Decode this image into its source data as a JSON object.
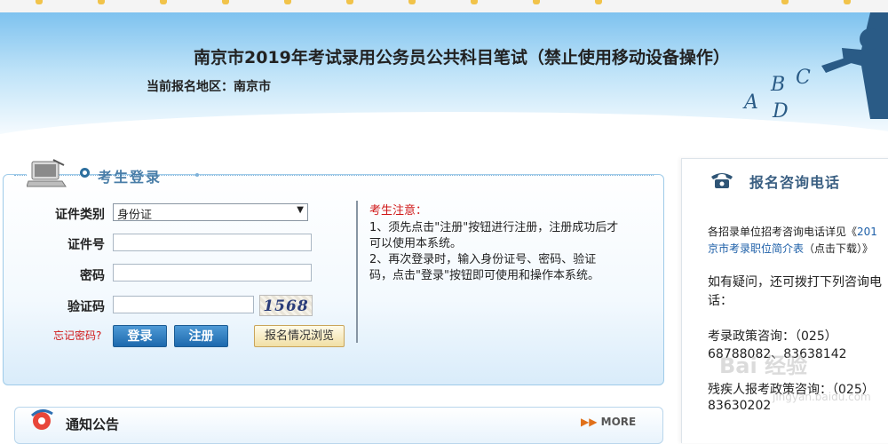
{
  "banner": {
    "title": "南京市2019年考试录用公务员公共科目笔试（禁止使用移动设备操作）",
    "region_label": "当前报名地区：",
    "region_value": "南京市",
    "art_letters": [
      "A",
      "B",
      "C",
      "D"
    ]
  },
  "login": {
    "title": "考生登录",
    "id_type_label": "证件类别",
    "id_type_value": "身份证",
    "id_number_label": "证件号",
    "password_label": "密码",
    "captcha_label": "验证码",
    "captcha_code": "1568",
    "forgot_password": "忘记密码?",
    "login_button": "登录",
    "register_button": "注册",
    "browse_button": "报名情况浏览"
  },
  "notice": {
    "title": "考生注意：",
    "lines": [
      "1、须先点击\"注册\"按钮进行注册，注册成功后才",
      "可以使用本系统。",
      "2、再次登录时，输入身份证号、密码、验证",
      "码，点击\"登录\"按钮即可使用和操作本系统。"
    ]
  },
  "consult": {
    "title": "报名咨询电话",
    "intro_text": "各招录单位招考咨询电话详见《",
    "intro_link": "201",
    "link_line2": "京市考录职位简介表",
    "download_text": "（点击下载）》",
    "question_line1": "如有疑问，还可拨打下列咨询电",
    "question_line2": "话：",
    "policy_label": "考录政策咨询：（025）",
    "policy_numbers": "68788082、83638142",
    "disabled_label": "残疾人报考政策咨询：（025）",
    "disabled_number": "83630202"
  },
  "announcement": {
    "title": "通知公告",
    "more": "MORE"
  },
  "watermark": {
    "text": "Bai 经验",
    "sub": "jingyan.baidu.com"
  },
  "colors": {
    "accent_blue": "#1d69ad",
    "notice_red": "#d01818",
    "title_blue": "#4a7ea8"
  }
}
